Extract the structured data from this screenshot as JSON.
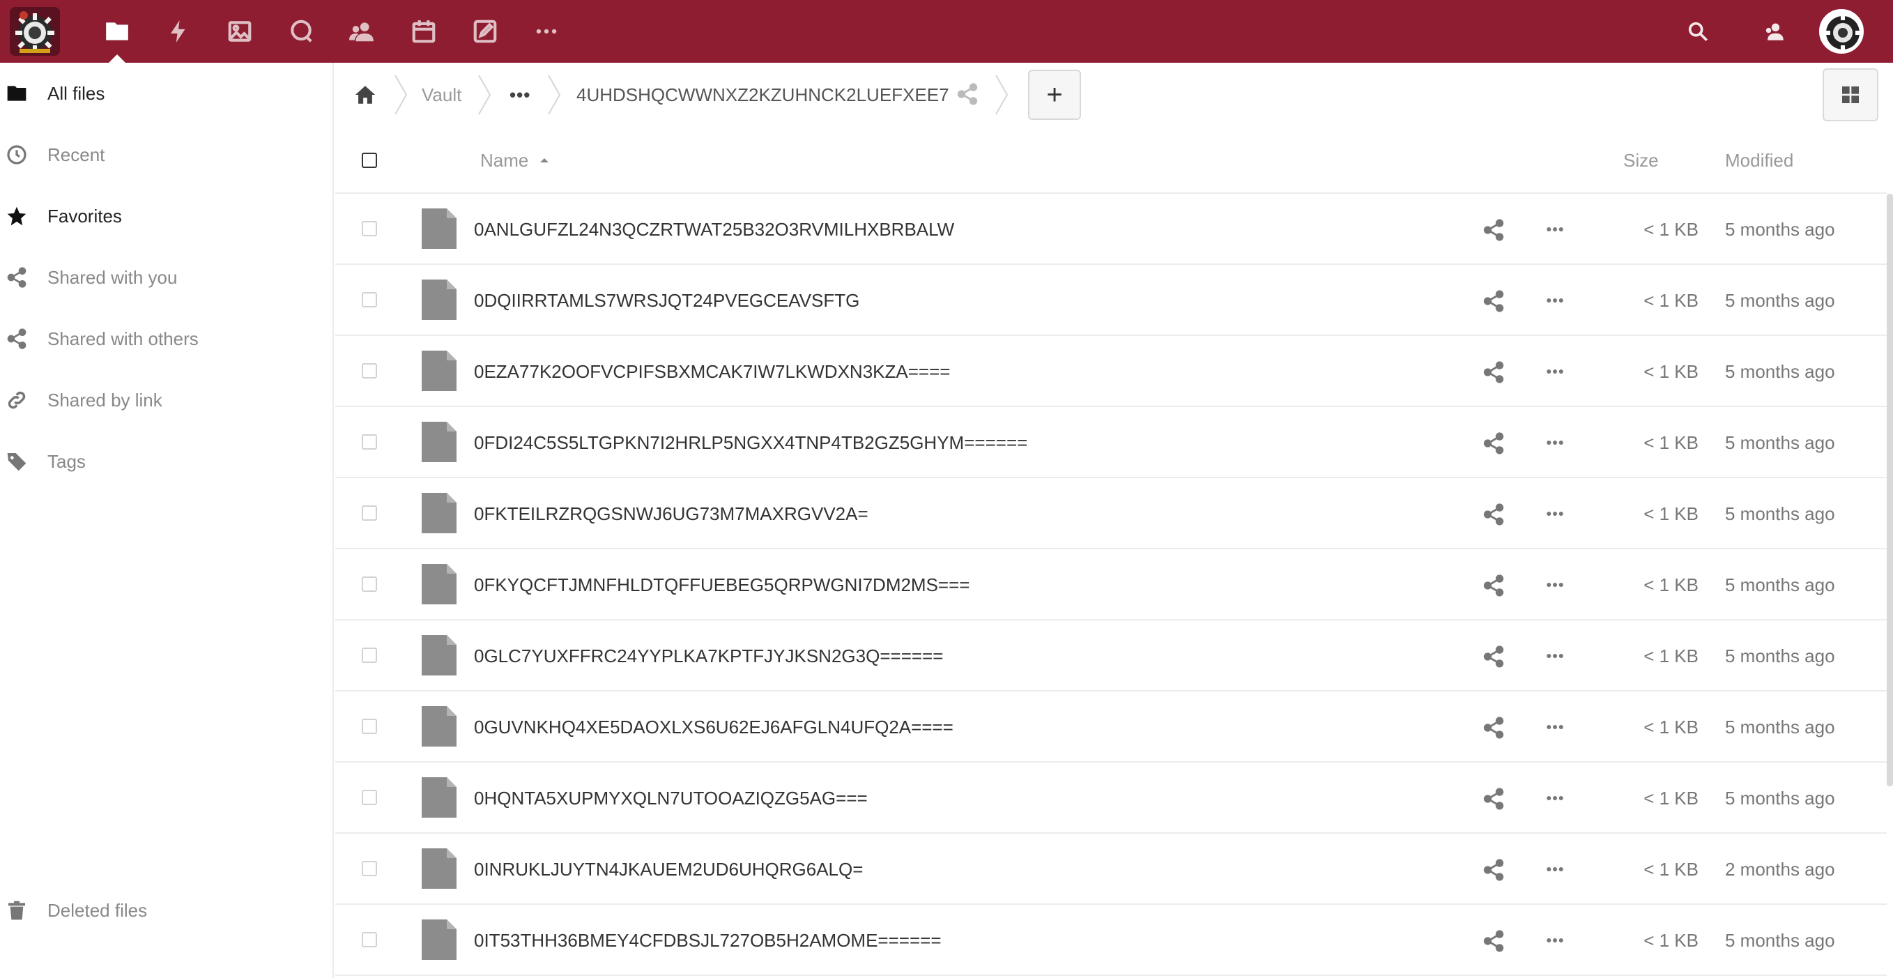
{
  "header": {
    "brand_color": "#8f1d31",
    "apps": [
      {
        "name": "Files",
        "icon": "folder-icon",
        "active": true
      },
      {
        "name": "Activity",
        "icon": "lightning-icon"
      },
      {
        "name": "Photos",
        "icon": "image-icon"
      },
      {
        "name": "Talk",
        "icon": "chat-bubble-icon"
      },
      {
        "name": "Contacts",
        "icon": "contacts-icon"
      },
      {
        "name": "Calendar",
        "icon": "calendar-icon"
      },
      {
        "name": "Notes",
        "icon": "edit-note-icon"
      },
      {
        "name": "More apps",
        "icon": "more-dots-icon"
      }
    ],
    "right_icons": [
      "search-icon",
      "contacts-menu-icon",
      "avatar"
    ]
  },
  "sidebar": {
    "items": [
      {
        "label": "All files",
        "icon": "folder-icon",
        "selected": true
      },
      {
        "label": "Recent",
        "icon": "clock-icon"
      },
      {
        "label": "Favorites",
        "icon": "star-icon"
      },
      {
        "label": "Shared with you",
        "icon": "share-icon"
      },
      {
        "label": "Shared with others",
        "icon": "share-icon"
      },
      {
        "label": "Shared by link",
        "icon": "link-icon"
      },
      {
        "label": "Tags",
        "icon": "tag-icon"
      }
    ],
    "footer": {
      "label": "Deleted files",
      "icon": "trash-icon"
    }
  },
  "breadcrumb": {
    "home_icon": "home-icon",
    "items": [
      "Vault",
      "•••",
      "4UHDSHQCWWNXZ2KZUHNCK2LUEFXEE7"
    ],
    "add_label": "+"
  },
  "table": {
    "columns": {
      "name": "Name",
      "size": "Size",
      "modified": "Modified"
    },
    "sort": "name-ascending",
    "rows": [
      {
        "name": "0ANLGUFZL24N3QCZRTWAT25B32O3RVMILHXBRBALW",
        "size": "< 1 KB",
        "modified": "5 months ago"
      },
      {
        "name": "0DQIIRRTAMLS7WRSJQT24PVEGCEAVSFTG",
        "size": "< 1 KB",
        "modified": "5 months ago"
      },
      {
        "name": "0EZA77K2OOFVCPIFSBXMCAK7IW7LKWDXN3KZA====",
        "size": "< 1 KB",
        "modified": "5 months ago"
      },
      {
        "name": "0FDI24C5S5LTGPKN7I2HRLP5NGXX4TNP4TB2GZ5GHYM======",
        "size": "< 1 KB",
        "modified": "5 months ago"
      },
      {
        "name": "0FKTEILRZRQGSNWJ6UG73M7MAXRGVV2A=",
        "size": "< 1 KB",
        "modified": "5 months ago"
      },
      {
        "name": "0FKYQCFTJMNFHLDTQFFUEBEG5QRPWGNI7DM2MS===",
        "size": "< 1 KB",
        "modified": "5 months ago"
      },
      {
        "name": "0GLC7YUXFFRC24YYPLKA7KPTFJYJKSN2G3Q======",
        "size": "< 1 KB",
        "modified": "5 months ago"
      },
      {
        "name": "0GUVNKHQ4XE5DAOXLXS6U62EJ6AFGLN4UFQ2A====",
        "size": "< 1 KB",
        "modified": "5 months ago"
      },
      {
        "name": "0HQNTA5XUPMYXQLN7UTOOAZIQZG5AG===",
        "size": "< 1 KB",
        "modified": "5 months ago"
      },
      {
        "name": "0INRUKLJUYTN4JKAUEM2UD6UHQRG6ALQ=",
        "size": "< 1 KB",
        "modified": "2 months ago"
      },
      {
        "name": "0IT53THH36BMEY4CFDBSJL727OB5H2AMOME======",
        "size": "< 1 KB",
        "modified": "5 months ago"
      }
    ]
  }
}
